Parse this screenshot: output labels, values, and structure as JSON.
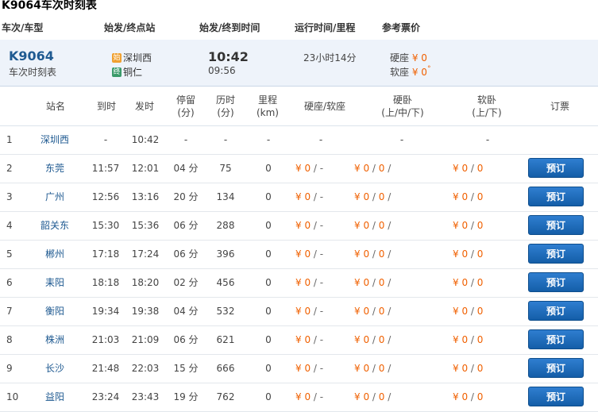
{
  "title": "K9064车次时刻表",
  "summary_header": {
    "col_train": "车次/车型",
    "col_stations": "始发/终点站",
    "col_times": "始发/终到时间",
    "col_run": "运行时间/里程",
    "col_price": "参考票价"
  },
  "summary": {
    "train_no": "K9064",
    "sub_label": "车次时刻表",
    "start_badge": "始",
    "start_station": "深圳西",
    "end_badge": "终",
    "end_station": "铜仁",
    "dep_time": "10:42",
    "arr_time": "09:56",
    "run_time": "23小时14分",
    "price_hard_seat_label": "硬座",
    "price_hard_seat": "¥ 0",
    "price_soft_seat_label": "软座",
    "price_soft_seat": "¥ 0"
  },
  "table_header": {
    "station": "站名",
    "arrive": "到时",
    "depart": "发时",
    "stop": "停留\n(分)",
    "elapsed": "历时\n(分)",
    "distance": "里程\n(km)",
    "seat": "硬座/软座",
    "hard_sleeper": "硬卧\n(上/中/下)",
    "soft_sleeper": "软卧\n(上/下)",
    "book": "订票"
  },
  "book_label": "预订",
  "rows": [
    {
      "idx": "1",
      "station": "深圳西",
      "arr": "-",
      "dep": "10:42",
      "stop": "-",
      "elapsed": "-",
      "km": "-",
      "seat": "-",
      "hsl": "-",
      "ssl": "-",
      "book": false
    },
    {
      "idx": "2",
      "station": "东莞",
      "arr": "11:57",
      "dep": "12:01",
      "stop": "04 分",
      "elapsed": "75",
      "km": "0",
      "seat_a": "¥ 0",
      "seat_b": "/ -",
      "hsl_a": "¥ 0",
      "hsl_b": "0",
      "hsl_c": "/",
      "ssl_a": "¥ 0",
      "ssl_b": "0",
      "book": true
    },
    {
      "idx": "3",
      "station": "广州",
      "arr": "12:56",
      "dep": "13:16",
      "stop": "20 分",
      "elapsed": "134",
      "km": "0",
      "seat_a": "¥ 0",
      "seat_b": "/ -",
      "hsl_a": "¥ 0",
      "hsl_b": "0",
      "hsl_c": "/",
      "ssl_a": "¥ 0",
      "ssl_b": "0",
      "book": true
    },
    {
      "idx": "4",
      "station": "韶关东",
      "arr": "15:30",
      "dep": "15:36",
      "stop": "06 分",
      "elapsed": "288",
      "km": "0",
      "seat_a": "¥ 0",
      "seat_b": "/ -",
      "hsl_a": "¥ 0",
      "hsl_b": "0",
      "hsl_c": "/",
      "ssl_a": "¥ 0",
      "ssl_b": "0",
      "book": true
    },
    {
      "idx": "5",
      "station": "郴州",
      "arr": "17:18",
      "dep": "17:24",
      "stop": "06 分",
      "elapsed": "396",
      "km": "0",
      "seat_a": "¥ 0",
      "seat_b": "/ -",
      "hsl_a": "¥ 0",
      "hsl_b": "0",
      "hsl_c": "/",
      "ssl_a": "¥ 0",
      "ssl_b": "0",
      "book": true
    },
    {
      "idx": "6",
      "station": "耒阳",
      "arr": "18:18",
      "dep": "18:20",
      "stop": "02 分",
      "elapsed": "456",
      "km": "0",
      "seat_a": "¥ 0",
      "seat_b": "/ -",
      "hsl_a": "¥ 0",
      "hsl_b": "0",
      "hsl_c": "/",
      "ssl_a": "¥ 0",
      "ssl_b": "0",
      "book": true
    },
    {
      "idx": "7",
      "station": "衡阳",
      "arr": "19:34",
      "dep": "19:38",
      "stop": "04 分",
      "elapsed": "532",
      "km": "0",
      "seat_a": "¥ 0",
      "seat_b": "/ -",
      "hsl_a": "¥ 0",
      "hsl_b": "0",
      "hsl_c": "/",
      "ssl_a": "¥ 0",
      "ssl_b": "0",
      "book": true
    },
    {
      "idx": "8",
      "station": "株洲",
      "arr": "21:03",
      "dep": "21:09",
      "stop": "06 分",
      "elapsed": "621",
      "km": "0",
      "seat_a": "¥ 0",
      "seat_b": "/ -",
      "hsl_a": "¥ 0",
      "hsl_b": "0",
      "hsl_c": "/",
      "ssl_a": "¥ 0",
      "ssl_b": "0",
      "book": true
    },
    {
      "idx": "9",
      "station": "长沙",
      "arr": "21:48",
      "dep": "22:03",
      "stop": "15 分",
      "elapsed": "666",
      "km": "0",
      "seat_a": "¥ 0",
      "seat_b": "/ -",
      "hsl_a": "¥ 0",
      "hsl_b": "0",
      "hsl_c": "/",
      "ssl_a": "¥ 0",
      "ssl_b": "0",
      "book": true
    },
    {
      "idx": "10",
      "station": "益阳",
      "arr": "23:24",
      "dep": "23:43",
      "stop": "19 分",
      "elapsed": "762",
      "km": "0",
      "seat_a": "¥ 0",
      "seat_b": "/ -",
      "hsl_a": "¥ 0",
      "hsl_b": "0",
      "hsl_c": "/",
      "ssl_a": "¥ 0",
      "ssl_b": "0",
      "book": true
    }
  ],
  "colors": {
    "accent": "#1f5a91",
    "price": "#f06000",
    "button": "#1a66b8"
  }
}
